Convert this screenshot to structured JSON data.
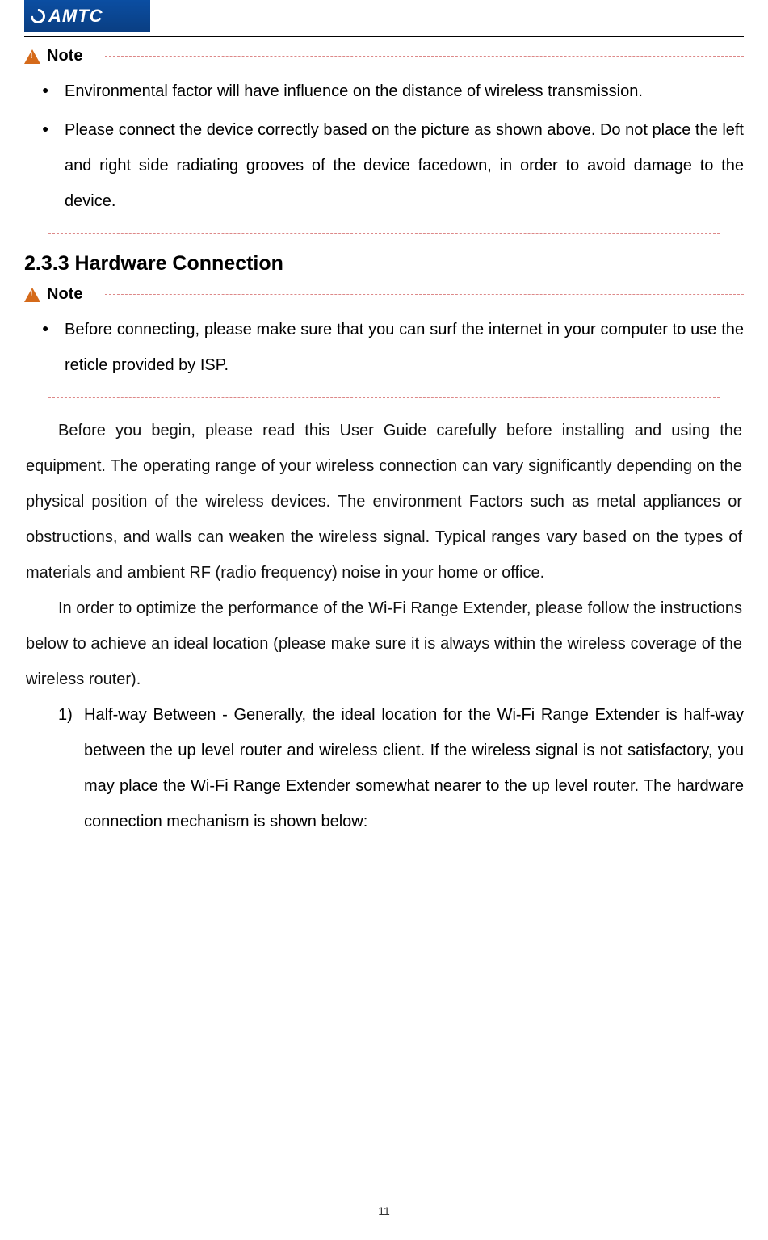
{
  "header": {
    "logo_text": "AMTC"
  },
  "note1": {
    "label": "Note",
    "bullets": [
      "Environmental factor will have influence on the distance of wireless transmission.",
      "Please connect the device correctly based on the picture as shown above. Do not place the left and right side radiating grooves of the device facedown, in order to avoid damage to the device."
    ]
  },
  "section": {
    "heading": "2.3.3 Hardware Connection"
  },
  "note2": {
    "label": "Note",
    "bullets": [
      "Before connecting, please make sure that you can surf the internet in your computer to use the reticle provided by ISP."
    ]
  },
  "paragraphs": [
    "Before you begin, please read this User Guide carefully before installing and using the equipment. The operating range of your wireless connection can vary significantly depending on the physical position of the wireless devices. The environment Factors such as metal appliances or obstructions, and walls can weaken the wireless signal. Typical ranges vary based on the types of materials and ambient RF (radio frequency) noise in your home or office.",
    "In order to optimize the performance of the Wi-Fi Range Extender, please follow the instructions below to achieve an ideal location (please make sure it is always within the wireless coverage of the wireless router)."
  ],
  "numbered": [
    {
      "num": "1)",
      "text": "Half-way Between - Generally, the ideal location for the Wi-Fi Range Extender is half-way between the up level router and wireless client. If the wireless signal is not satisfactory, you may place the Wi-Fi Range Extender somewhat nearer to the up level router. The hardware connection mechanism is shown below:"
    }
  ],
  "page_number": "11"
}
